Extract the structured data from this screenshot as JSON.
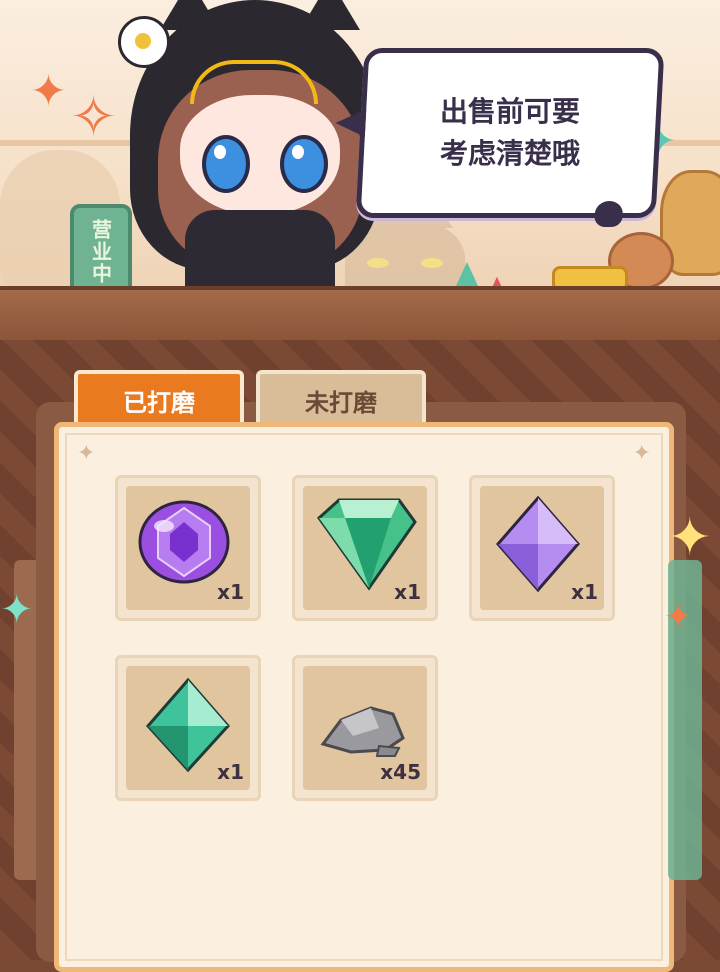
{
  "scene": {
    "sign_text": "营业中",
    "speech_line1": "出售前可要",
    "speech_line2": "考虑清楚哦"
  },
  "tabs": {
    "active_label": "已打磨",
    "inactive_label": "未打磨"
  },
  "inventory": [
    {
      "item": "purple-round-gem",
      "qty": "x1"
    },
    {
      "item": "green-cut-gem",
      "qty": "x1"
    },
    {
      "item": "violet-crystal",
      "qty": "x1"
    },
    {
      "item": "teal-crystal",
      "qty": "x1"
    },
    {
      "item": "gray-stone",
      "qty": "x45"
    }
  ],
  "colors": {
    "tab_active": "#ea7a20",
    "tab_inactive": "#d8bd98",
    "board_border": "#f0b878"
  }
}
